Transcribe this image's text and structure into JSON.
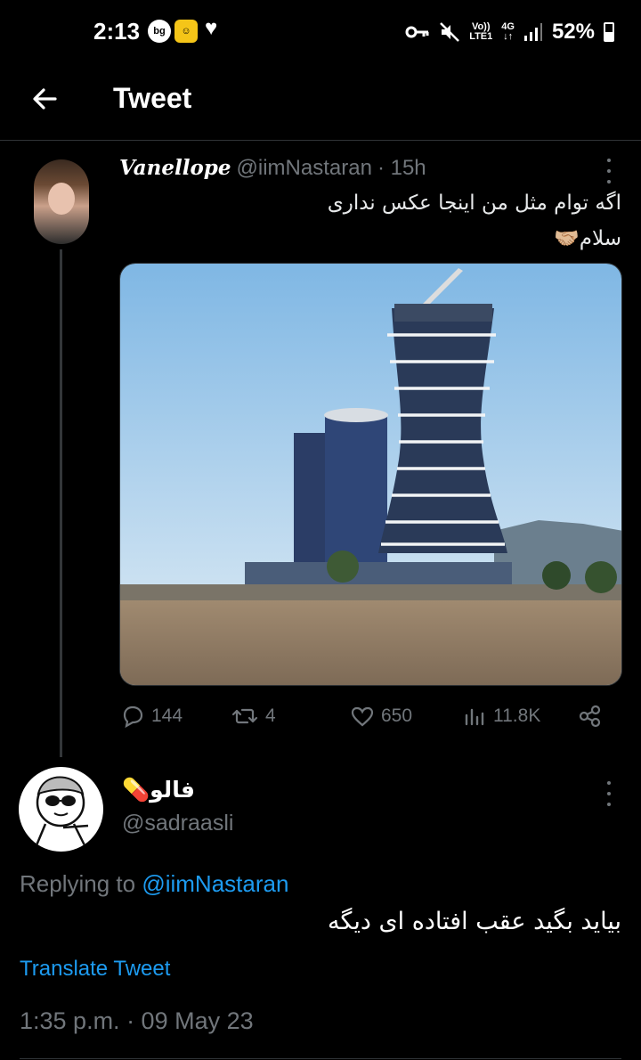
{
  "status_bar": {
    "time": "2:13",
    "notif_1": "bg",
    "notif_2": "☺",
    "volte": "Vo))",
    "lte": "LTE1",
    "network": "4G",
    "battery": "52%"
  },
  "header": {
    "title": "Tweet"
  },
  "tweet": {
    "display_name": "Vanellope",
    "handle": "@iimNastaran",
    "time": "· 15h",
    "text_line1": "اگه توام مثل من اینجا عکس نداری",
    "text_line2": "سلام🤝🏼",
    "stats": {
      "replies": "144",
      "retweets": "4",
      "likes": "650",
      "views": "11.8K"
    }
  },
  "reply": {
    "display_name": "فالو💊",
    "handle": "@sadraasli",
    "replying_label": "Replying to",
    "replying_mention": "@iimNastaran",
    "text": "بیاید بگید عقب افتاده ای دیگه",
    "translate": "Translate Tweet",
    "timestamp": "1:35 p.m. · 09 May 23"
  }
}
